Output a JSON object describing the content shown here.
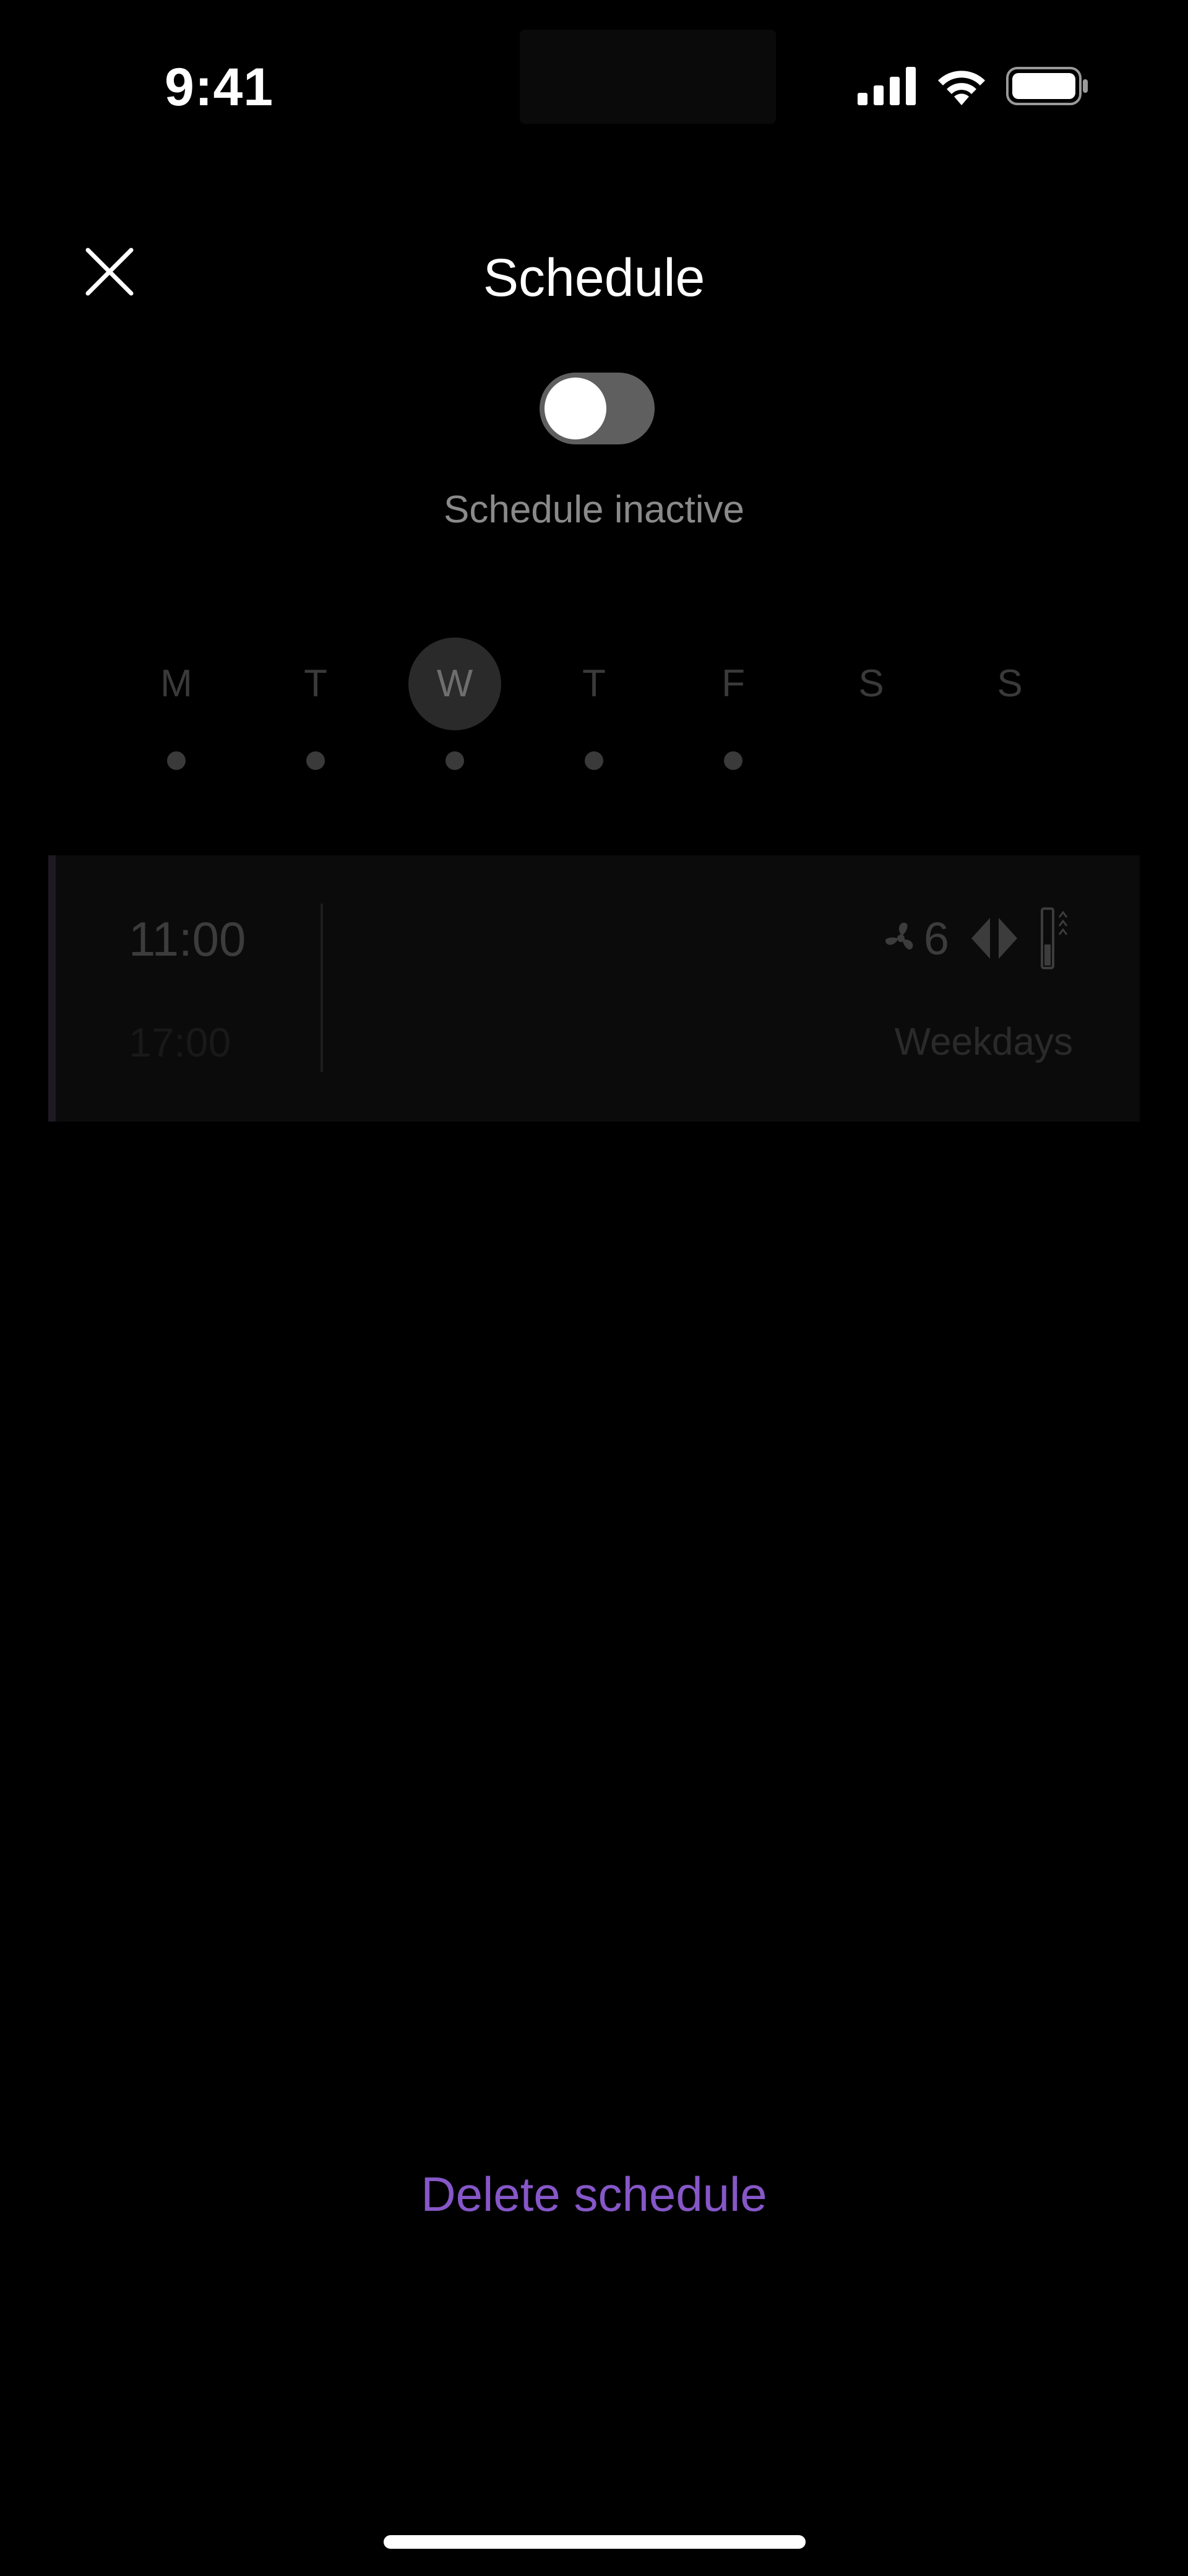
{
  "status_bar": {
    "time": "9:41",
    "icons": [
      "cellular-signal-icon",
      "wifi-icon",
      "battery-icon"
    ]
  },
  "header": {
    "title": "Schedule",
    "close_icon": "close-icon"
  },
  "toggle": {
    "state": "off",
    "status_text": "Schedule inactive"
  },
  "days": [
    {
      "letter": "M",
      "has_schedule": true,
      "selected": false
    },
    {
      "letter": "T",
      "has_schedule": true,
      "selected": false
    },
    {
      "letter": "W",
      "has_schedule": true,
      "selected": true
    },
    {
      "letter": "T",
      "has_schedule": true,
      "selected": false
    },
    {
      "letter": "F",
      "has_schedule": true,
      "selected": false
    },
    {
      "letter": "S",
      "has_schedule": false,
      "selected": false
    },
    {
      "letter": "S",
      "has_schedule": false,
      "selected": false
    }
  ],
  "schedule": {
    "start_time": "11:00",
    "end_time": "17:00",
    "fan_speed": "6",
    "icons": [
      "fan-icon",
      "oscillation-icon",
      "heat-icon"
    ],
    "days_label": "Weekdays"
  },
  "actions": {
    "delete_label": "Delete schedule"
  },
  "colors": {
    "background": "#000000",
    "accent": "#8657c8",
    "toggle_track_off": "#5f5f5f"
  }
}
